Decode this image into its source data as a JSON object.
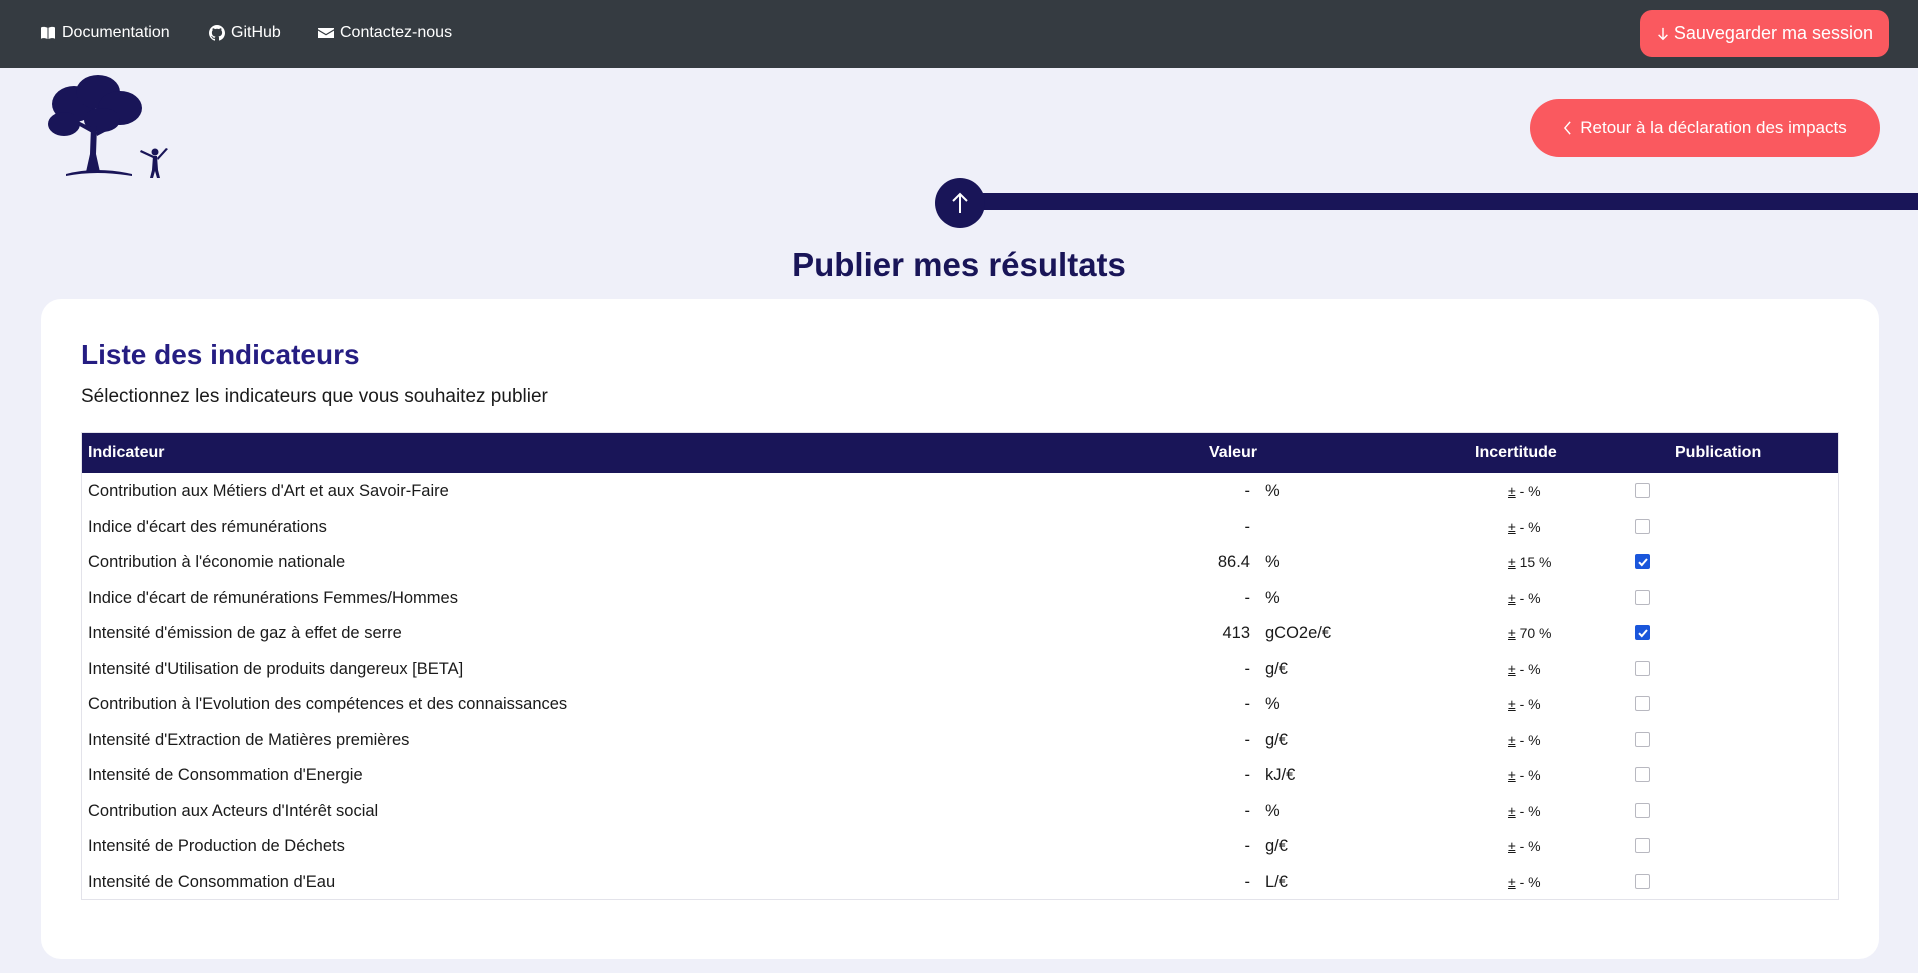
{
  "nav": {
    "documentation": "Documentation",
    "github": "GitHub",
    "contact": "Contactez-nous",
    "save": "Sauvegarder ma session"
  },
  "back_button": "Retour à la déclaration des impacts",
  "page_title": "Publier mes résultats",
  "card": {
    "title": "Liste des indicateurs",
    "subtitle": "Sélectionnez les indicateurs que vous souhaitez publier"
  },
  "table": {
    "headers": {
      "indicator": "Indicateur",
      "value": "Valeur",
      "uncertainty": "Incertitude",
      "publication": "Publication"
    },
    "uncertainty_prefix": "±",
    "uncertainty_suffix": "%",
    "rows": [
      {
        "name": "Contribution aux Métiers d'Art et aux Savoir-Faire",
        "value": "-",
        "unit": "%",
        "uncertainty": "-",
        "checked": false
      },
      {
        "name": "Indice d'écart des rémunérations",
        "value": "-",
        "unit": "",
        "uncertainty": "-",
        "checked": false
      },
      {
        "name": "Contribution à l'économie nationale",
        "value": "86.4",
        "unit": "%",
        "uncertainty": "15",
        "checked": true
      },
      {
        "name": "Indice d'écart de rémunérations Femmes/Hommes",
        "value": "-",
        "unit": "%",
        "uncertainty": "-",
        "checked": false
      },
      {
        "name": "Intensité d'émission de gaz à effet de serre",
        "value": "413",
        "unit": "gCO2e/€",
        "uncertainty": "70",
        "checked": true
      },
      {
        "name": "Intensité d'Utilisation de produits dangereux [BETA]",
        "value": "-",
        "unit": "g/€",
        "uncertainty": "-",
        "checked": false
      },
      {
        "name": "Contribution à l'Evolution des compétences et des connaissances",
        "value": "-",
        "unit": "%",
        "uncertainty": "-",
        "checked": false
      },
      {
        "name": "Intensité d'Extraction de Matières premières",
        "value": "-",
        "unit": "g/€",
        "uncertainty": "-",
        "checked": false
      },
      {
        "name": "Intensité de Consommation d'Energie",
        "value": "-",
        "unit": "kJ/€",
        "uncertainty": "-",
        "checked": false
      },
      {
        "name": "Contribution aux Acteurs d'Intérêt social",
        "value": "-",
        "unit": "%",
        "uncertainty": "-",
        "checked": false
      },
      {
        "name": "Intensité de Production de Déchets",
        "value": "-",
        "unit": "g/€",
        "uncertainty": "-",
        "checked": false
      },
      {
        "name": "Intensité de Consommation d'Eau",
        "value": "-",
        "unit": "L/€",
        "uncertainty": "-",
        "checked": false
      }
    ]
  },
  "colors": {
    "primary": "#191558",
    "accent": "#fa595f",
    "nav_bg": "#353b41",
    "page_bg": "#eff0f9",
    "checkbox": "#1a56db"
  },
  "icons": {
    "documentation": "book-icon",
    "github": "github-icon",
    "contact": "envelope-icon",
    "save": "arrow-down-icon",
    "back": "chevron-left-icon",
    "step": "arrow-up-icon"
  }
}
